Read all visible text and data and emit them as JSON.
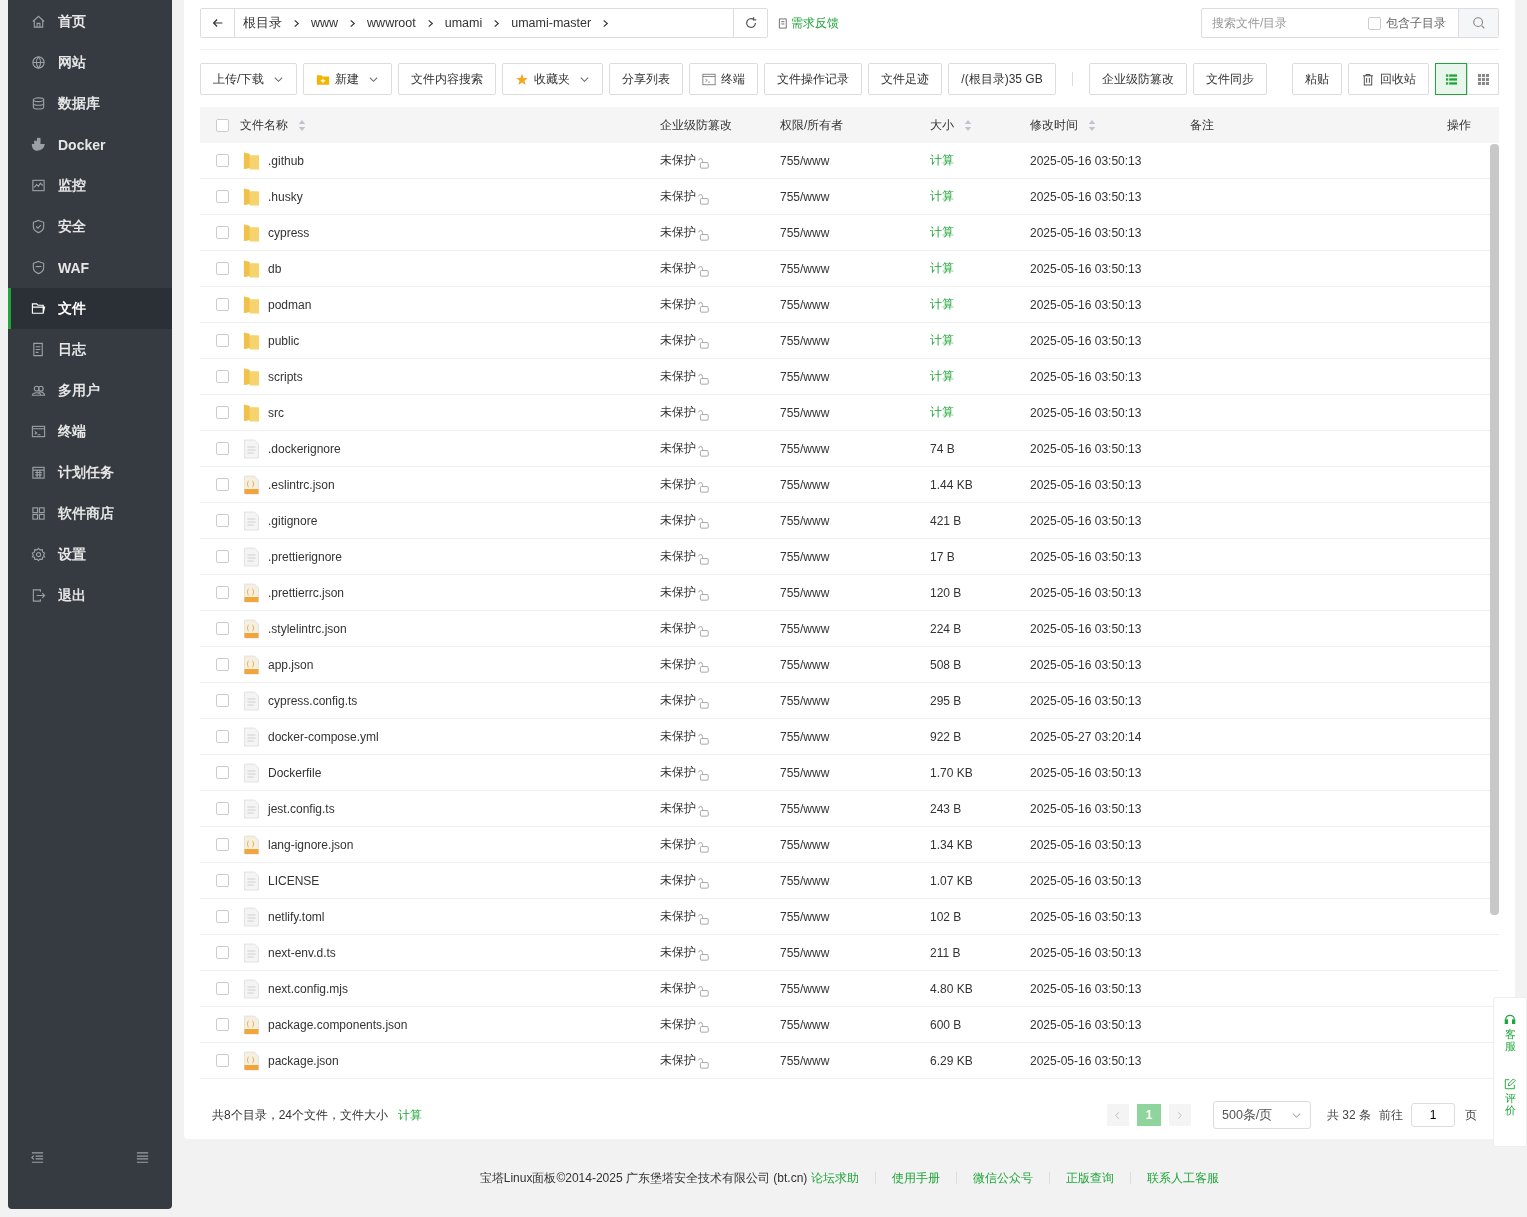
{
  "sidebar": {
    "items": [
      {
        "label": "首页",
        "selected": false
      },
      {
        "label": "网站",
        "selected": false
      },
      {
        "label": "数据库",
        "selected": false
      },
      {
        "label": "Docker",
        "selected": false
      },
      {
        "label": "监控",
        "selected": false
      },
      {
        "label": "安全",
        "selected": false
      },
      {
        "label": "WAF",
        "selected": false
      },
      {
        "label": "文件",
        "selected": true
      },
      {
        "label": "日志",
        "selected": false
      },
      {
        "label": "多用户",
        "selected": false
      },
      {
        "label": "终端",
        "selected": false
      },
      {
        "label": "计划任务",
        "selected": false
      },
      {
        "label": "软件商店",
        "selected": false
      },
      {
        "label": "设置",
        "selected": false
      },
      {
        "label": "退出",
        "selected": false
      }
    ]
  },
  "breadcrumb": [
    "根目录",
    "www",
    "wwwroot",
    "umami",
    "umami-master"
  ],
  "feedback_link": "需求反馈",
  "search": {
    "placeholder": "搜索文件/目录",
    "include_subdirs": {
      "label": "包含子目录",
      "checked": false
    }
  },
  "toolbar": {
    "left": [
      {
        "label": "上传/下载",
        "kind": "dropdown"
      },
      {
        "label": "新建",
        "kind": "new"
      },
      {
        "label": "文件内容搜索",
        "kind": "plain"
      },
      {
        "label": "收藏夹",
        "kind": "favorites"
      },
      {
        "label": "分享列表",
        "kind": "plain"
      },
      {
        "label": "终端",
        "kind": "terminal"
      },
      {
        "label": "文件操作记录",
        "kind": "plain"
      },
      {
        "label": "文件足迹",
        "kind": "plain"
      },
      {
        "label": "/(根目录)35 GB",
        "kind": "plain"
      }
    ],
    "middle": [
      {
        "label": "企业级防篡改"
      },
      {
        "label": "文件同步"
      }
    ],
    "right": [
      {
        "label": "粘贴",
        "kind": "plain"
      },
      {
        "label": "回收站",
        "kind": "recycle"
      }
    ],
    "views": [
      {
        "kind": "list",
        "selected": true
      },
      {
        "kind": "grid",
        "selected": false
      }
    ]
  },
  "table": {
    "select_all": {
      "checked": false
    },
    "columns": [
      {
        "label": "文件名称",
        "sortable": true
      },
      {
        "label": "企业级防篡改",
        "sortable": false
      },
      {
        "label": "权限/所有者",
        "sortable": false
      },
      {
        "label": "大小",
        "sortable": true
      },
      {
        "label": "修改时间",
        "sortable": true
      },
      {
        "label": "备注",
        "sortable": false
      },
      {
        "label": "操作",
        "sortable": false
      }
    ],
    "rows": [
      {
        "name": ".github",
        "kind": "folder",
        "checked": false,
        "protection": "未保护",
        "permission": "755/www",
        "size": "计算",
        "modified": "2025-05-16 03:50:13"
      },
      {
        "name": ".husky",
        "kind": "folder",
        "checked": false,
        "protection": "未保护",
        "permission": "755/www",
        "size": "计算",
        "modified": "2025-05-16 03:50:13"
      },
      {
        "name": "cypress",
        "kind": "folder",
        "checked": false,
        "protection": "未保护",
        "permission": "755/www",
        "size": "计算",
        "modified": "2025-05-16 03:50:13"
      },
      {
        "name": "db",
        "kind": "folder",
        "checked": false,
        "protection": "未保护",
        "permission": "755/www",
        "size": "计算",
        "modified": "2025-05-16 03:50:13"
      },
      {
        "name": "podman",
        "kind": "folder",
        "checked": false,
        "protection": "未保护",
        "permission": "755/www",
        "size": "计算",
        "modified": "2025-05-16 03:50:13"
      },
      {
        "name": "public",
        "kind": "folder",
        "checked": false,
        "protection": "未保护",
        "permission": "755/www",
        "size": "计算",
        "modified": "2025-05-16 03:50:13"
      },
      {
        "name": "scripts",
        "kind": "folder",
        "checked": false,
        "protection": "未保护",
        "permission": "755/www",
        "size": "计算",
        "modified": "2025-05-16 03:50:13"
      },
      {
        "name": "src",
        "kind": "folder",
        "checked": false,
        "protection": "未保护",
        "permission": "755/www",
        "size": "计算",
        "modified": "2025-05-16 03:50:13"
      },
      {
        "name": ".dockerignore",
        "kind": "file",
        "checked": false,
        "protection": "未保护",
        "permission": "755/www",
        "size": "74 B",
        "modified": "2025-05-16 03:50:13"
      },
      {
        "name": ".eslintrc.json",
        "kind": "json",
        "checked": false,
        "protection": "未保护",
        "permission": "755/www",
        "size": "1.44 KB",
        "modified": "2025-05-16 03:50:13"
      },
      {
        "name": ".gitignore",
        "kind": "file",
        "checked": false,
        "protection": "未保护",
        "permission": "755/www",
        "size": "421 B",
        "modified": "2025-05-16 03:50:13"
      },
      {
        "name": ".prettierignore",
        "kind": "file",
        "checked": false,
        "protection": "未保护",
        "permission": "755/www",
        "size": "17 B",
        "modified": "2025-05-16 03:50:13"
      },
      {
        "name": ".prettierrc.json",
        "kind": "json",
        "checked": false,
        "protection": "未保护",
        "permission": "755/www",
        "size": "120 B",
        "modified": "2025-05-16 03:50:13"
      },
      {
        "name": ".stylelintrc.json",
        "kind": "json",
        "checked": false,
        "protection": "未保护",
        "permission": "755/www",
        "size": "224 B",
        "modified": "2025-05-16 03:50:13"
      },
      {
        "name": "app.json",
        "kind": "json",
        "checked": false,
        "protection": "未保护",
        "permission": "755/www",
        "size": "508 B",
        "modified": "2025-05-16 03:50:13"
      },
      {
        "name": "cypress.config.ts",
        "kind": "file",
        "checked": false,
        "protection": "未保护",
        "permission": "755/www",
        "size": "295 B",
        "modified": "2025-05-16 03:50:13"
      },
      {
        "name": "docker-compose.yml",
        "kind": "file",
        "checked": false,
        "protection": "未保护",
        "permission": "755/www",
        "size": "922 B",
        "modified": "2025-05-27 03:20:14"
      },
      {
        "name": "Dockerfile",
        "kind": "file",
        "checked": false,
        "protection": "未保护",
        "permission": "755/www",
        "size": "1.70 KB",
        "modified": "2025-05-16 03:50:13"
      },
      {
        "name": "jest.config.ts",
        "kind": "file",
        "checked": false,
        "protection": "未保护",
        "permission": "755/www",
        "size": "243 B",
        "modified": "2025-05-16 03:50:13"
      },
      {
        "name": "lang-ignore.json",
        "kind": "json",
        "checked": false,
        "protection": "未保护",
        "permission": "755/www",
        "size": "1.34 KB",
        "modified": "2025-05-16 03:50:13"
      },
      {
        "name": "LICENSE",
        "kind": "file",
        "checked": false,
        "protection": "未保护",
        "permission": "755/www",
        "size": "1.07 KB",
        "modified": "2025-05-16 03:50:13"
      },
      {
        "name": "netlify.toml",
        "kind": "file",
        "checked": false,
        "protection": "未保护",
        "permission": "755/www",
        "size": "102 B",
        "modified": "2025-05-16 03:50:13"
      },
      {
        "name": "next-env.d.ts",
        "kind": "file",
        "checked": false,
        "protection": "未保护",
        "permission": "755/www",
        "size": "211 B",
        "modified": "2025-05-16 03:50:13"
      },
      {
        "name": "next.config.mjs",
        "kind": "file",
        "checked": false,
        "protection": "未保护",
        "permission": "755/www",
        "size": "4.80 KB",
        "modified": "2025-05-16 03:50:13"
      },
      {
        "name": "package.components.json",
        "kind": "json",
        "checked": false,
        "protection": "未保护",
        "permission": "755/www",
        "size": "600 B",
        "modified": "2025-05-16 03:50:13"
      },
      {
        "name": "package.json",
        "kind": "json",
        "checked": false,
        "protection": "未保护",
        "permission": "755/www",
        "size": "6.29 KB",
        "modified": "2025-05-16 03:50:13"
      }
    ]
  },
  "summary": {
    "text": "共8个目录，24个文件，文件大小",
    "link": "计算"
  },
  "pagination": {
    "pages": [
      {
        "label": "1",
        "selected": true
      }
    ],
    "page_size": "500条/页",
    "total": "共 32 条",
    "goto_label": "前往",
    "goto_value": "1",
    "page_suffix": "页"
  },
  "footer": {
    "copyright": "宝塔Linux面板©2014-2025 广东堡塔安全技术有限公司 (bt.cn)",
    "links": [
      "论坛求助",
      "使用手册",
      "微信公众号",
      "正版查询",
      "联系人工客服"
    ]
  },
  "side_widget": [
    {
      "label": "客服",
      "kind": "service"
    },
    {
      "label": "评价",
      "kind": "review"
    }
  ]
}
